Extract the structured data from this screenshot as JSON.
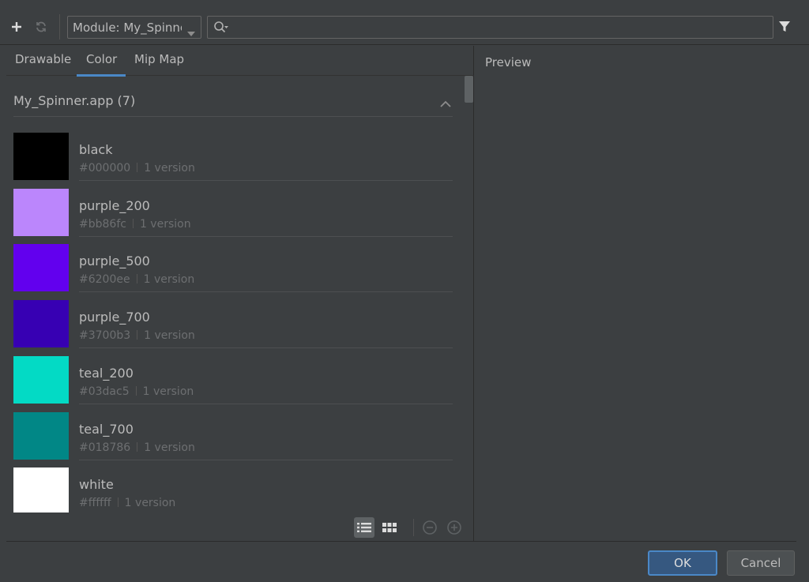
{
  "toolbar": {
    "add_icon": "plus-icon",
    "refresh_icon": "refresh-icon",
    "module_select_value": "Module: My_Spinner",
    "search_value": "",
    "filter_icon": "filter-icon"
  },
  "tabs": [
    {
      "label": "Drawable",
      "active": false
    },
    {
      "label": "Color",
      "active": true
    },
    {
      "label": "Mip Map",
      "active": false
    }
  ],
  "group": {
    "title": "My_Spinner.app (7)"
  },
  "resources": [
    {
      "name": "black",
      "value": "#000000",
      "versions": "1 version",
      "color": "#000000"
    },
    {
      "name": "purple_200",
      "value": "#bb86fc",
      "versions": "1 version",
      "color": "#bb86fc"
    },
    {
      "name": "purple_500",
      "value": "#6200ee",
      "versions": "1 version",
      "color": "#6200ee"
    },
    {
      "name": "purple_700",
      "value": "#3700b3",
      "versions": "1 version",
      "color": "#3700b3"
    },
    {
      "name": "teal_200",
      "value": "#03dac5",
      "versions": "1 version",
      "color": "#03dac5"
    },
    {
      "name": "teal_700",
      "value": "#018786",
      "versions": "1 version",
      "color": "#018786"
    },
    {
      "name": "white",
      "value": "#ffffff",
      "versions": "1 version",
      "color": "#ffffff"
    }
  ],
  "preview": {
    "label": "Preview"
  },
  "footer": {
    "ok_label": "OK",
    "cancel_label": "Cancel"
  },
  "colors": {
    "accent": "#4a88c7",
    "background": "#3c3f41"
  }
}
